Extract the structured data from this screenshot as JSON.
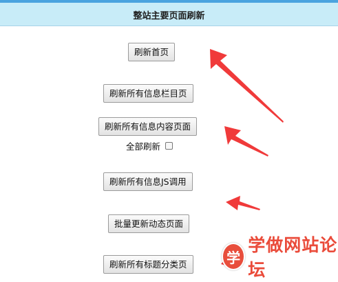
{
  "header": {
    "title": "整站主要页面刷新"
  },
  "buttons": {
    "home": "刷新首页",
    "info_column": "刷新所有信息栏目页",
    "info_content": "刷新所有信息内容页面",
    "info_js": "刷新所有信息JS调用",
    "dynamic_batch": "批量更新动态页面",
    "topic_category": "刷新所有标题分类页"
  },
  "all_refresh": {
    "label": "全部刷新",
    "checked": false
  },
  "watermark": {
    "logo_char": "学",
    "text": "学做网站论坛"
  },
  "colors": {
    "header_bg": "#c8ecf8",
    "top_rule": "#4aa3df",
    "annotation_arrow": "#f03a3a",
    "watermark": "#ea4b3a"
  }
}
